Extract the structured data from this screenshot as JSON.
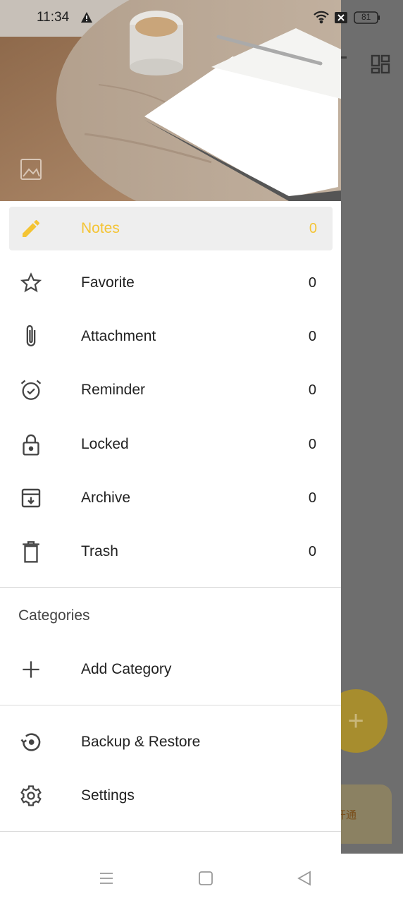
{
  "status_bar": {
    "time": "11:34",
    "battery": "81"
  },
  "drawer": {
    "items": [
      {
        "name": "notes",
        "label": "Notes",
        "count": "0",
        "active": true
      },
      {
        "name": "favorite",
        "label": "Favorite",
        "count": "0"
      },
      {
        "name": "attachment",
        "label": "Attachment",
        "count": "0"
      },
      {
        "name": "reminder",
        "label": "Reminder",
        "count": "0"
      },
      {
        "name": "locked",
        "label": "Locked",
        "count": "0"
      },
      {
        "name": "archive",
        "label": "Archive",
        "count": "0"
      },
      {
        "name": "trash",
        "label": "Trash",
        "count": "0"
      }
    ],
    "categories_title": "Categories",
    "add_category_label": "Add Category",
    "backup_label": "Backup & Restore",
    "settings_label": "Settings"
  },
  "background_app": {
    "banner_text": "开通"
  },
  "colors": {
    "accent": "#f4c434",
    "text": "#222222",
    "icon": "#444444"
  }
}
